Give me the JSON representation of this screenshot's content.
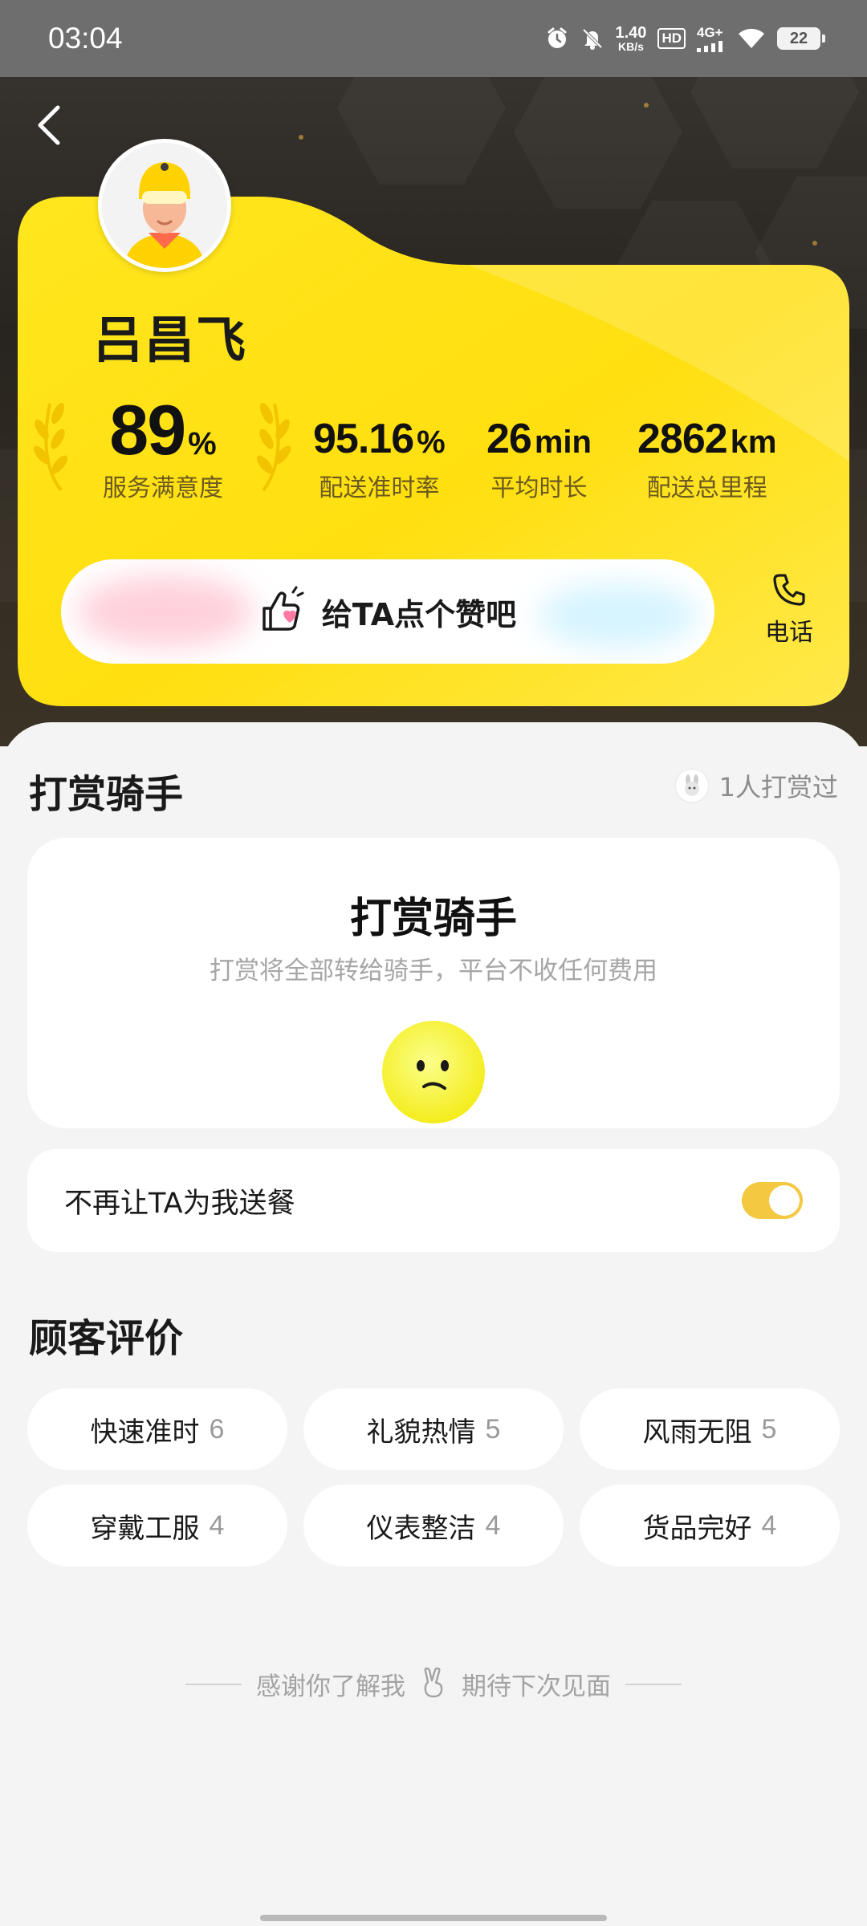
{
  "status_bar": {
    "time": "03:04",
    "speed_value": "1.40",
    "speed_unit": "KB/s",
    "hd": "HD",
    "network": "4G+",
    "battery": "22",
    "icons": [
      "alarm-icon",
      "mute-icon",
      "signal-icon",
      "wifi-icon",
      "battery-icon"
    ]
  },
  "header": {
    "back_icon": "chevron-left-icon"
  },
  "rider": {
    "name": "吕昌飞",
    "stats": [
      {
        "value": "89",
        "unit": "%",
        "label": "服务满意度"
      },
      {
        "value": "95.16",
        "unit": "%",
        "label": "配送准时率"
      },
      {
        "value": "26",
        "unit": "min",
        "label": "平均时长"
      },
      {
        "value": "2862",
        "unit": "km",
        "label": "配送总里程"
      }
    ],
    "like_label": "给TA点个赞吧",
    "phone_label": "电话"
  },
  "tip": {
    "section_title": "打赏骑手",
    "tippers_text": "1人打赏过",
    "card_title": "打赏骑手",
    "card_subtitle": "打赏将全部转给骑手，平台不收任何费用"
  },
  "block": {
    "label": "不再让TA为我送餐",
    "enabled": true
  },
  "reviews": {
    "section_title": "顾客评价",
    "tags": [
      {
        "label": "快速准时",
        "count": "6"
      },
      {
        "label": "礼貌热情",
        "count": "5"
      },
      {
        "label": "风雨无阻",
        "count": "5"
      },
      {
        "label": "穿戴工服",
        "count": "4"
      },
      {
        "label": "仪表整洁",
        "count": "4"
      },
      {
        "label": "货品完好",
        "count": "4"
      }
    ]
  },
  "footer": {
    "left": "感谢你了解我",
    "right": "期待下次见面"
  },
  "colors": {
    "accent_yellow": "#FFE21A",
    "toggle_on": "#F5C842",
    "background": "#F4F4F4"
  }
}
